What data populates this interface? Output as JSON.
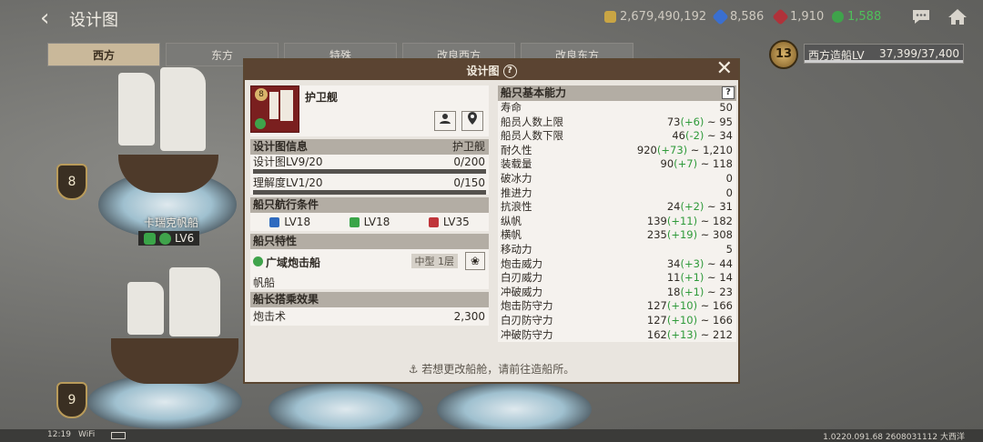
{
  "header": {
    "title": "设计图",
    "currencies": [
      {
        "icon": "gold-coin-icon",
        "value": "2,679,490,192",
        "color": "#c9a544"
      },
      {
        "icon": "blue-gem-icon",
        "value": "8,586",
        "color": "#3a6fd0"
      },
      {
        "icon": "red-gem-icon",
        "value": "1,910",
        "color": "#b0323a"
      },
      {
        "icon": "green-token-icon",
        "value": "1,588",
        "color": "#3fa34b"
      }
    ]
  },
  "tabs": [
    "西方",
    "东方",
    "特殊",
    "改良西方",
    "改良东方"
  ],
  "active_tab": "西方",
  "shipyard": {
    "level": "13",
    "label": "西方造船LV",
    "progress": "37,399/37,400",
    "fraction": 0.99997
  },
  "ships": [
    {
      "level": "8",
      "name": "卡瑞克帆船",
      "tag": "LV6"
    },
    {
      "level": "9"
    }
  ],
  "modal": {
    "title": "设计图",
    "ship": {
      "level": "8",
      "name": "护卫舰"
    },
    "design_info": {
      "title": "设计图信息",
      "type": "护卫舰",
      "rows": [
        {
          "label": "设计图LV9/20",
          "value": "0/200",
          "progress": 0
        },
        {
          "label": "理解度LV1/20",
          "value": "0/150",
          "progress": 0
        }
      ]
    },
    "conditions": {
      "title": "船只航行条件",
      "items": [
        {
          "icon": "adventure-icon",
          "value": "LV18",
          "color": "#2f6bbf"
        },
        {
          "icon": "trade-icon",
          "value": "LV18",
          "color": "#3aa548"
        },
        {
          "icon": "battle-icon",
          "value": "LV35",
          "color": "#c0353b"
        }
      ]
    },
    "traits": {
      "title": "船只特性",
      "name": "广域炮击船",
      "size": "中型 1层",
      "category": "帆船"
    },
    "captain": {
      "title": "船长搭乘效果",
      "label": "炮击术",
      "value": "2,300"
    },
    "stats": {
      "title": "船只基本能力",
      "help": "?",
      "rows": [
        {
          "label": "寿命",
          "base": "50",
          "bonus": "",
          "max": ""
        },
        {
          "label": "船员人数上限",
          "base": "73",
          "bonus": "(+6)",
          "max": " ~ 95"
        },
        {
          "label": "船员人数下限",
          "base": "46",
          "bonus": "(-2)",
          "max": " ~ 34"
        },
        {
          "label": "耐久性",
          "base": "920",
          "bonus": "(+73)",
          "max": " ~ 1,210"
        },
        {
          "label": "装载量",
          "base": "90",
          "bonus": "(+7)",
          "max": " ~ 118"
        },
        {
          "label": "破冰力",
          "base": "0",
          "bonus": "",
          "max": ""
        },
        {
          "label": "推进力",
          "base": "0",
          "bonus": "",
          "max": ""
        },
        {
          "label": "抗浪性",
          "base": "24",
          "bonus": "(+2)",
          "max": " ~ 31"
        },
        {
          "label": "纵帆",
          "base": "139",
          "bonus": "(+11)",
          "max": " ~ 182"
        },
        {
          "label": "横帆",
          "base": "235",
          "bonus": "(+19)",
          "max": " ~ 308"
        },
        {
          "label": "移动力",
          "base": "5",
          "bonus": "",
          "max": ""
        },
        {
          "label": "炮击威力",
          "base": "34",
          "bonus": "(+3)",
          "max": " ~ 44"
        },
        {
          "label": "白刃威力",
          "base": "11",
          "bonus": "(+1)",
          "max": " ~ 14"
        },
        {
          "label": "冲破威力",
          "base": "18",
          "bonus": "(+1)",
          "max": " ~ 23"
        },
        {
          "label": "炮击防守力",
          "base": "127",
          "bonus": "(+10)",
          "max": " ~ 166"
        },
        {
          "label": "白刃防守力",
          "base": "127",
          "bonus": "(+10)",
          "max": " ~ 166"
        },
        {
          "label": "冲破防守力",
          "base": "162",
          "bonus": "(+13)",
          "max": " ~ 212"
        }
      ]
    },
    "footer": "若想更改船舱，请前往造船所。"
  },
  "system_bar": {
    "time": "12:19",
    "wifi": "WiFi",
    "version": "1.0220.091.68 2608031112 大西洋"
  }
}
